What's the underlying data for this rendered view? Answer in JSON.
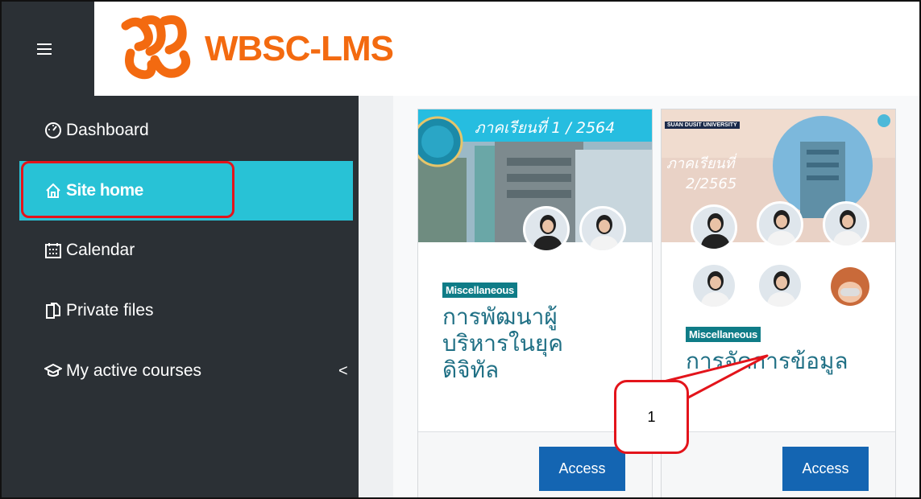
{
  "header": {
    "logo_text": "WBSC-LMS",
    "menu_icon": "hamburger-icon",
    "brand_color": "#f36a10"
  },
  "sidebar": {
    "items": [
      {
        "label": "Dashboard",
        "icon": "gauge-icon"
      },
      {
        "label": "Site home",
        "icon": "home-icon",
        "active": true
      },
      {
        "label": "Calendar",
        "icon": "calendar-icon"
      },
      {
        "label": "Private files",
        "icon": "files-icon"
      },
      {
        "label": "My active courses",
        "icon": "graduation-cap-icon",
        "chevron": "<"
      }
    ],
    "active_color": "#28c2d6",
    "bg_color": "#2b3035"
  },
  "courses": [
    {
      "image_banner": "ภาคเรียนที่ 1 / 2564",
      "category": "Miscellaneous",
      "title_lines": [
        "การพัฒนาผู้",
        "บริหารในยุค",
        "ดิจิทัล"
      ],
      "button": "Access"
    },
    {
      "image_header": "SUAN DUSIT UNIVERSITY",
      "image_banner_line1": "ภาคเรียนที่",
      "image_banner_line2": "2/2565",
      "category": "Miscellaneous",
      "title_lines": [
        "การจัดการข้อมูล"
      ],
      "button": "Access"
    }
  ],
  "callout": {
    "label": "1",
    "color": "#e3141b"
  }
}
